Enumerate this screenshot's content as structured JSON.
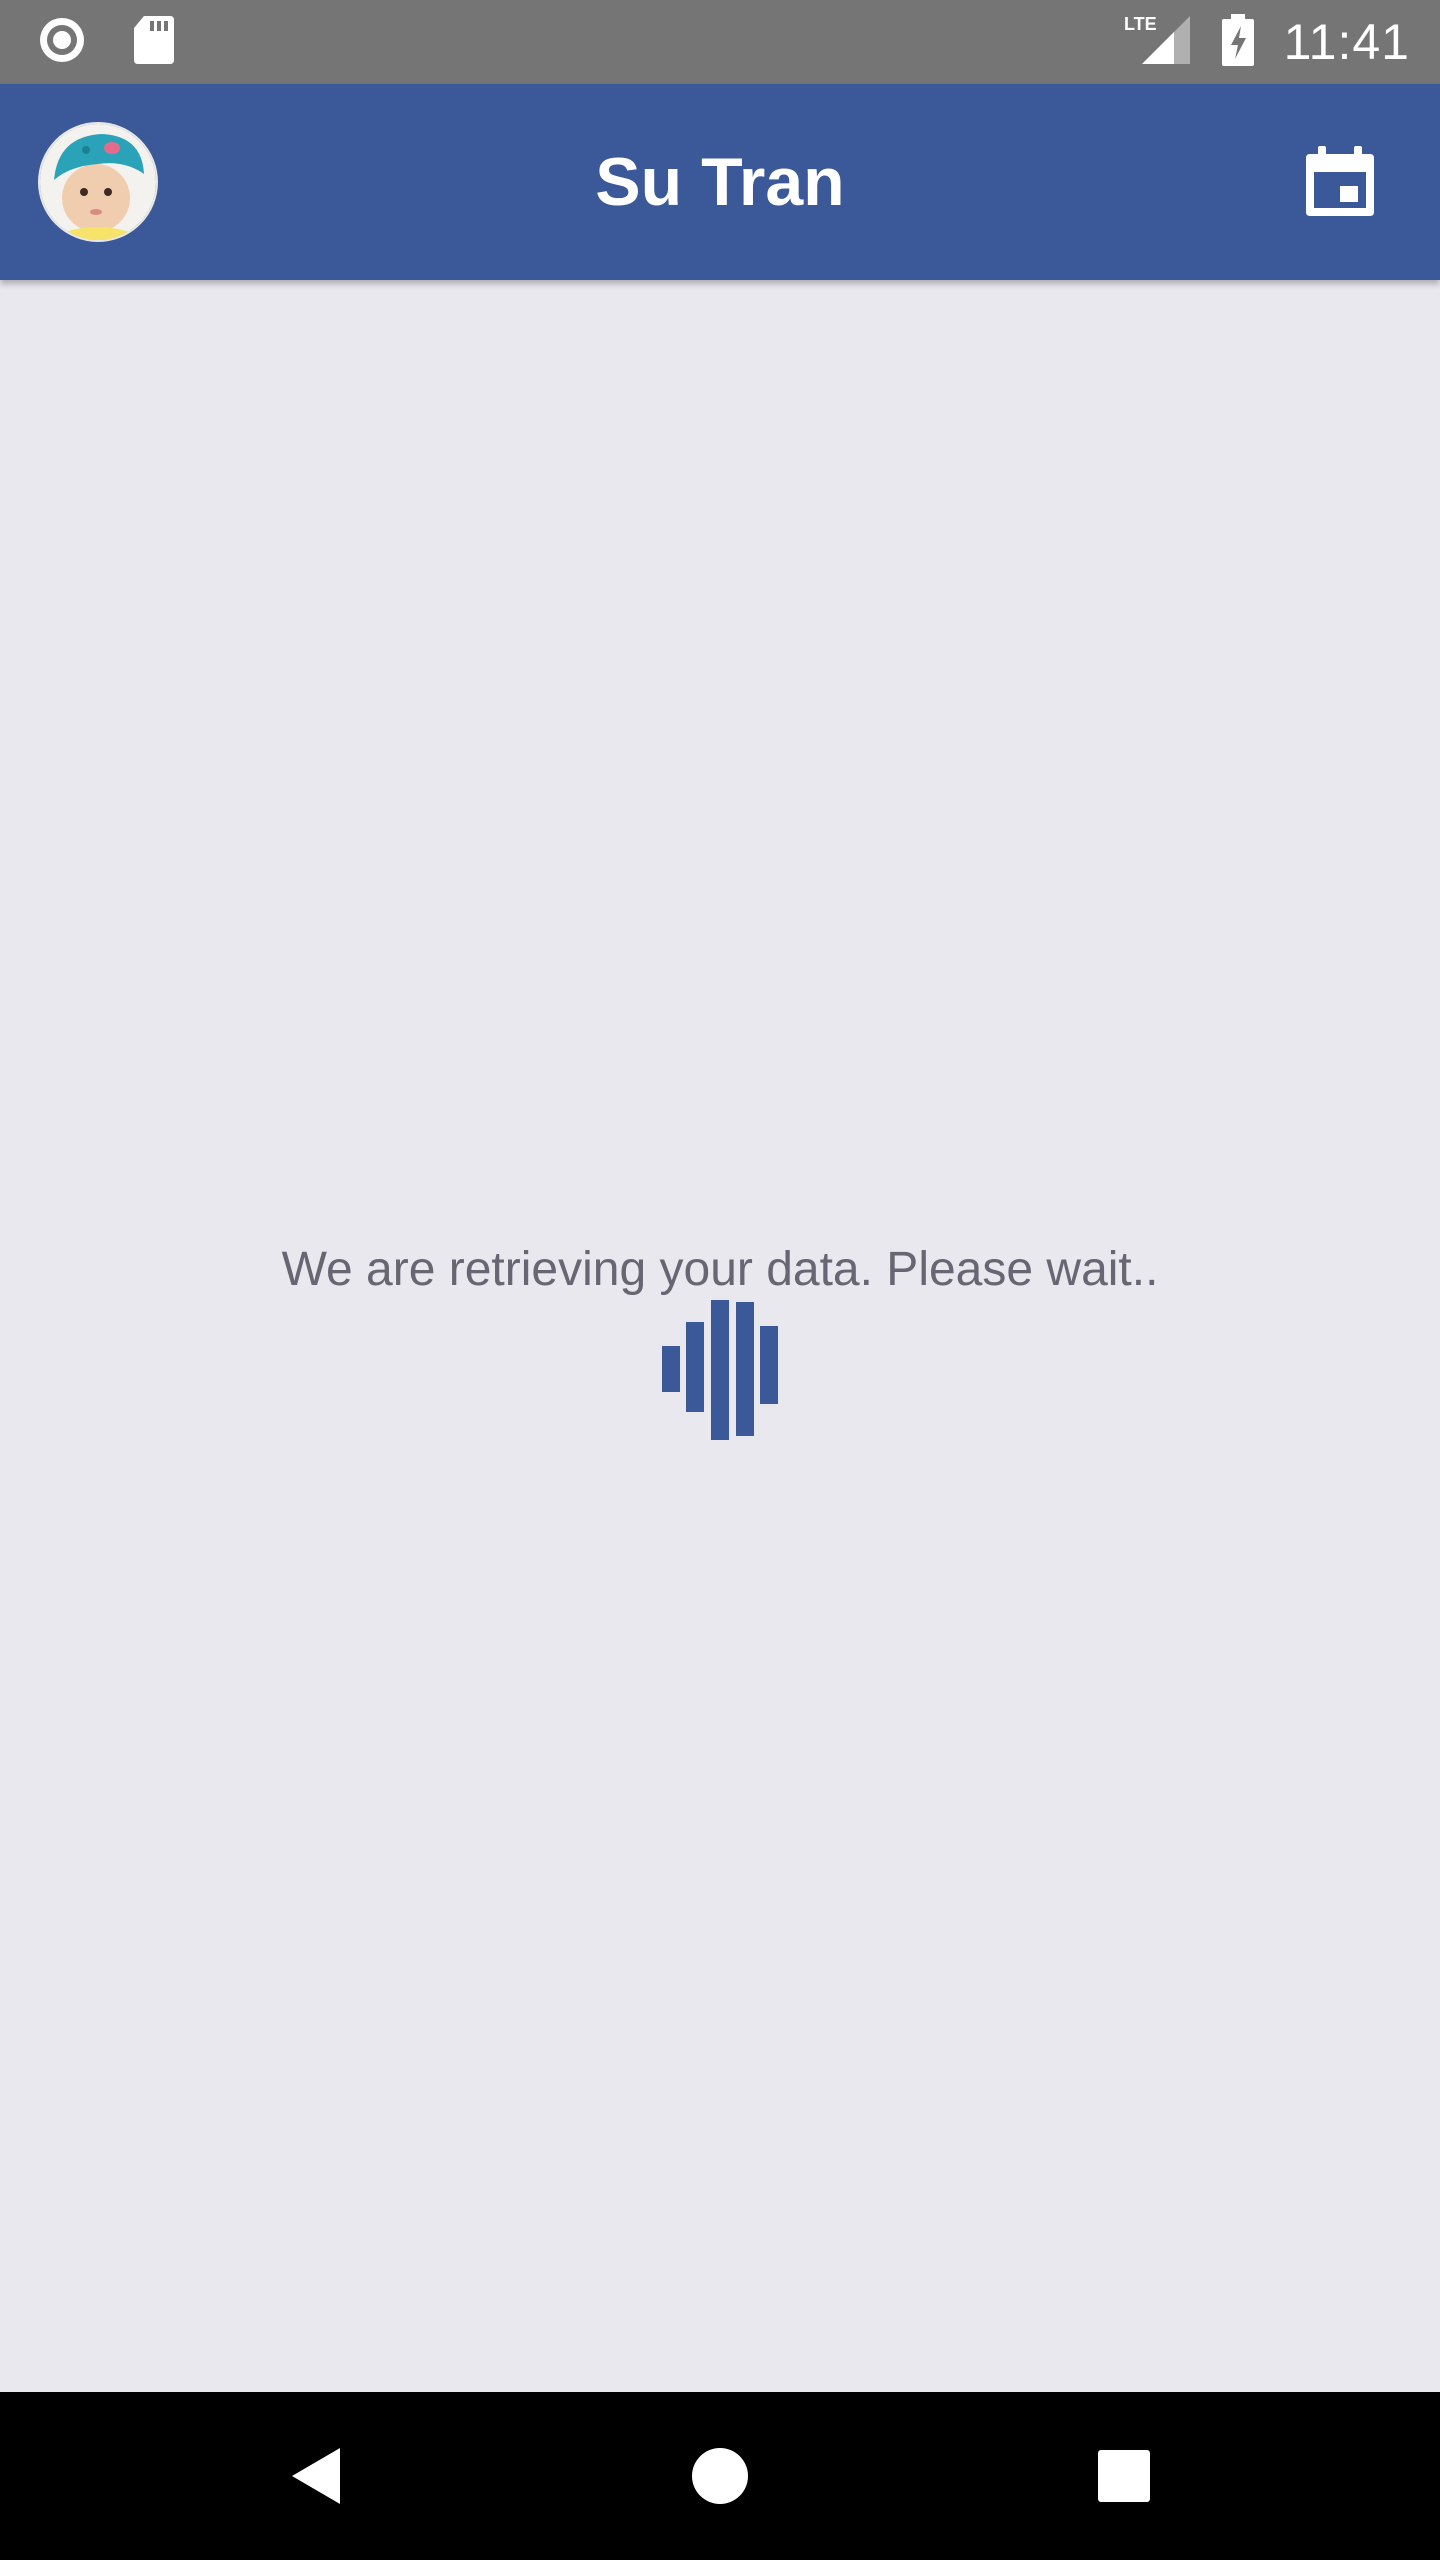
{
  "status_bar": {
    "time": "11:41",
    "network_label": "LTE",
    "icons": [
      "recording-icon",
      "sd-card-icon",
      "signal-icon",
      "battery-charging-icon"
    ]
  },
  "app_bar": {
    "title": "Su Tran",
    "avatar_icon": "profile-avatar",
    "action_icon": "calendar-icon"
  },
  "main": {
    "loading_message": "We are retrieving your data. Please wait..",
    "loader_icon": "wave-bars-loader"
  },
  "nav_bar": {
    "icons": [
      "back-icon",
      "home-icon",
      "recents-icon"
    ]
  },
  "colors": {
    "brand": "#3b5998",
    "background": "#e9e8ef",
    "status_bar": "#757575",
    "loading_text": "#676672"
  }
}
